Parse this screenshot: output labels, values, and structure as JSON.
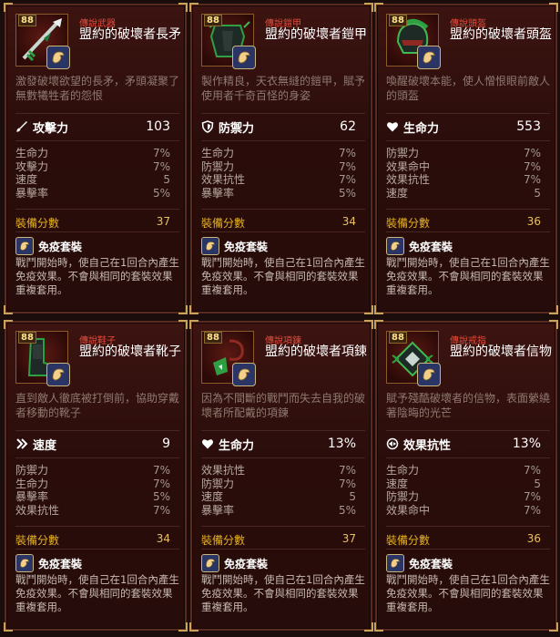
{
  "cards": [
    {
      "level": "88",
      "grade": "傳說武器",
      "name": "盟約的破壞者長矛",
      "desc": "激發破壞欲望的長矛，矛頭凝聚了無數犧牲者的怨恨",
      "main_icon": "sword-icon",
      "main_label": "攻擊力",
      "main_value": "103",
      "subs": [
        {
          "label": "生命力",
          "value": "7%"
        },
        {
          "label": "攻擊力",
          "value": "7%"
        },
        {
          "label": "速度",
          "value": "5"
        },
        {
          "label": "暴擊率",
          "value": "5%"
        }
      ],
      "gear_score_label": "裝備分數",
      "gear_score": "37",
      "set_name": "免疫套裝",
      "set_desc": "戰鬥開始時，使自己在1回合內產生免疫效果。不會與相同的套裝效果重複套用。"
    },
    {
      "level": "88",
      "grade": "傳說鎧甲",
      "name": "盟約的破壞者鎧甲",
      "desc": "製作精良，天衣無縫的鎧甲，賦予使用者千奇百怪的身姿",
      "main_icon": "shield-icon",
      "main_label": "防禦力",
      "main_value": "62",
      "subs": [
        {
          "label": "生命力",
          "value": "7%"
        },
        {
          "label": "防禦力",
          "value": "7%"
        },
        {
          "label": "效果抗性",
          "value": "7%"
        },
        {
          "label": "暴擊率",
          "value": "5%"
        }
      ],
      "gear_score_label": "裝備分數",
      "gear_score": "34",
      "set_name": "免疫套裝",
      "set_desc": "戰鬥開始時，使自己在1回合內產生免疫效果。不會與相同的套裝效果重複套用。"
    },
    {
      "level": "88",
      "grade": "傳說頭盔",
      "name": "盟約的破壞者頭盔",
      "desc": "喚醒破壞本能，使人憎恨眼前敵人的頭盔",
      "main_icon": "heart-icon",
      "main_label": "生命力",
      "main_value": "553",
      "subs": [
        {
          "label": "防禦力",
          "value": "7%"
        },
        {
          "label": "效果命中",
          "value": "7%"
        },
        {
          "label": "效果抗性",
          "value": "7%"
        },
        {
          "label": "速度",
          "value": "5"
        }
      ],
      "gear_score_label": "裝備分數",
      "gear_score": "36",
      "set_name": "免疫套裝",
      "set_desc": "戰鬥開始時，使自己在1回合內產生免疫效果。不會與相同的套裝效果重複套用。"
    },
    {
      "level": "88",
      "grade": "傳說鞋子",
      "name": "盟約的破壞者靴子",
      "desc": "直到敵人徹底被打倒前，協助穿戴者移動的靴子",
      "main_icon": "speed-icon",
      "main_label": "速度",
      "main_value": "9",
      "subs": [
        {
          "label": "防禦力",
          "value": "7%"
        },
        {
          "label": "生命力",
          "value": "7%"
        },
        {
          "label": "暴擊率",
          "value": "5%"
        },
        {
          "label": "效果抗性",
          "value": "7%"
        }
      ],
      "gear_score_label": "裝備分數",
      "gear_score": "34",
      "set_name": "免疫套裝",
      "set_desc": "戰鬥開始時，使自己在1回合內產生免疫效果。不會與相同的套裝效果重複套用。"
    },
    {
      "level": "88",
      "grade": "傳說項鍊",
      "name": "盟約的破壞者項鍊",
      "desc": "因為不間斷的戰鬥而失去自我的破壞者所配戴的項鍊",
      "main_icon": "heart-icon",
      "main_label": "生命力",
      "main_value": "13%",
      "subs": [
        {
          "label": "效果抗性",
          "value": "7%"
        },
        {
          "label": "防禦力",
          "value": "7%"
        },
        {
          "label": "速度",
          "value": "5"
        },
        {
          "label": "暴擊率",
          "value": "5%"
        }
      ],
      "gear_score_label": "裝備分數",
      "gear_score": "37",
      "set_name": "免疫套裝",
      "set_desc": "戰鬥開始時，使自己在1回合內產生免疫效果。不會與相同的套裝效果重複套用。"
    },
    {
      "level": "88",
      "grade": "傳說戒指",
      "name": "盟約的破壞者信物",
      "desc": "賦予殘酷破壞者的信物，表面縈繞著陰晦的光芒",
      "main_icon": "resist-icon",
      "main_label": "效果抗性",
      "main_value": "13%",
      "subs": [
        {
          "label": "生命力",
          "value": "7%"
        },
        {
          "label": "速度",
          "value": "5"
        },
        {
          "label": "防禦力",
          "value": "7%"
        },
        {
          "label": "效果命中",
          "value": "7%"
        }
      ],
      "gear_score_label": "裝備分數",
      "gear_score": "36",
      "set_name": "免疫套裝",
      "set_desc": "戰鬥開始時，使自己在1回合內產生免疫效果。不會與相同的套裝效果重複套用。"
    }
  ],
  "colors": {
    "grade": "#e54a3a",
    "gear_score": "#e6b21f",
    "card_border": "#5a2a1e"
  }
}
